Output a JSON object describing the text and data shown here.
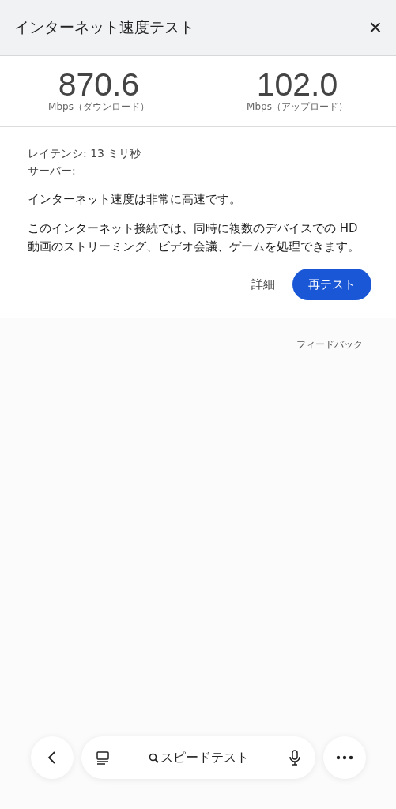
{
  "header": {
    "title": "インターネット速度テスト",
    "close": "×"
  },
  "speeds": [
    {
      "value": "870.6",
      "unit": "Mbps（ダウンロード）"
    },
    {
      "value": "102.0",
      "unit": "Mbps（アップロード）"
    }
  ],
  "details": {
    "latency": "レイテンシ: 13 ミリ秒",
    "server": "サーバー:",
    "summary": "インターネット速度は非常に高速です。",
    "description": "このインターネット接続では、同時に複数のデバイスでの HD 動画のストリーミング、ビデオ会議、ゲームを処理できます。"
  },
  "actions": [
    {
      "label": "詳細",
      "kind": "text"
    },
    {
      "label": "再テスト",
      "kind": "primary"
    }
  ],
  "feedback": "フィードバック",
  "bottom_bar": {
    "query": "スピードテスト"
  }
}
